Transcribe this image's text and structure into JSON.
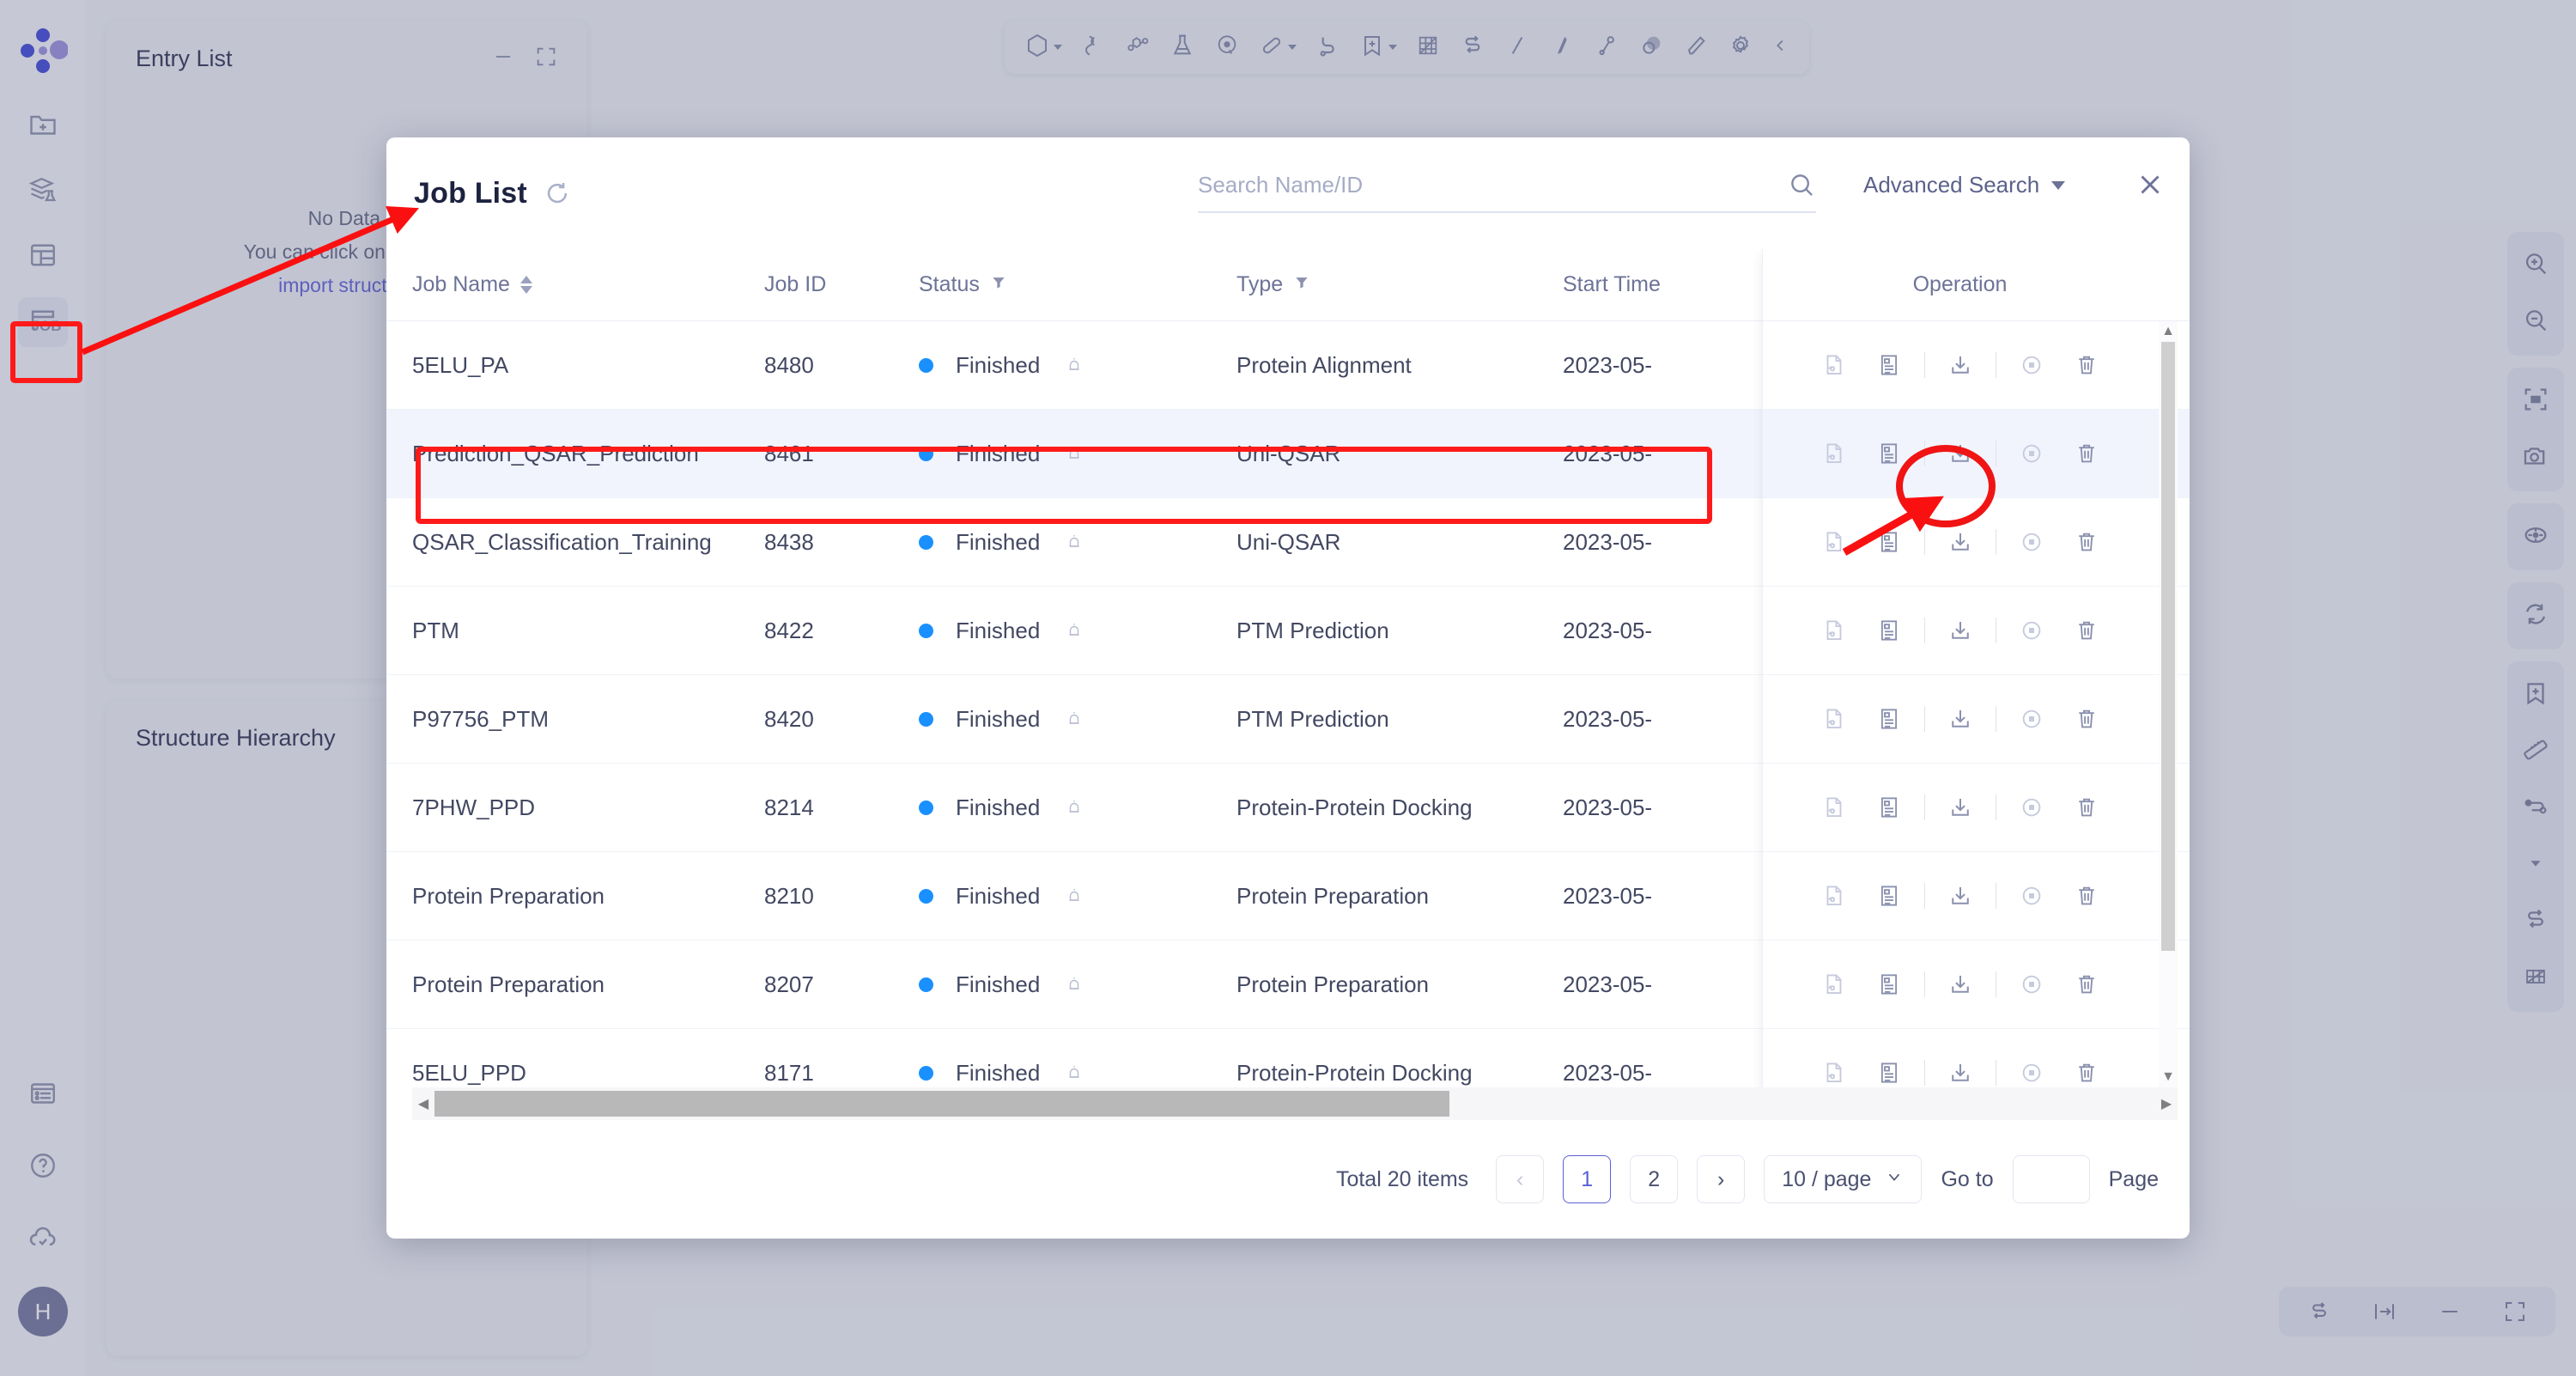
{
  "app": {
    "rail": {
      "logo_name": "app-logo",
      "items": [
        {
          "name": "new-folder",
          "icon": "folder-plus-icon"
        },
        {
          "name": "library",
          "icon": "stack-flask-icon"
        },
        {
          "name": "table-view",
          "icon": "table-icon"
        },
        {
          "name": "job-list",
          "icon": "job-icon",
          "label": "JOB",
          "active": true
        }
      ],
      "bottom_items": [
        {
          "name": "news",
          "icon": "browser-list-icon"
        },
        {
          "name": "help",
          "icon": "question-circle-icon"
        },
        {
          "name": "cloud-sync",
          "icon": "cloud-check-icon"
        }
      ],
      "avatar_initial": "H"
    },
    "toolbar": {
      "items": [
        {
          "name": "shape-tool",
          "icon": "hexagon-icon",
          "caret": true
        },
        {
          "name": "ribbon-tool",
          "icon": "ribbon-icon",
          "caret": false
        },
        {
          "name": "molecule-tool",
          "icon": "molecule-icon",
          "caret": false
        },
        {
          "name": "flask-tool",
          "icon": "flask-icon",
          "caret": false
        },
        {
          "name": "surface-tool",
          "icon": "surface-icon",
          "caret": false
        },
        {
          "name": "pill-tool",
          "icon": "capsule-icon",
          "caret": true
        },
        {
          "name": "chain-tool",
          "icon": "chain-icon",
          "caret": false
        },
        {
          "name": "label-tool",
          "icon": "bookmark-plus-icon",
          "caret": true
        },
        {
          "name": "map-tool",
          "icon": "mesh-icon",
          "caret": false
        },
        {
          "name": "exchange-tool",
          "icon": "exchange-icon",
          "caret": false
        },
        {
          "name": "line-tool",
          "icon": "slash-icon",
          "caret": false
        },
        {
          "name": "stick-tool",
          "icon": "stick-icon",
          "caret": false
        },
        {
          "name": "bond-tool",
          "icon": "bond-icon",
          "caret": false
        },
        {
          "name": "sphere-tool",
          "icon": "spheres-icon",
          "caret": false
        },
        {
          "name": "pencil-tool",
          "icon": "pencil-icon",
          "caret": false
        },
        {
          "name": "settings-tool",
          "icon": "gear-icon",
          "caret": false
        },
        {
          "name": "collapse-toolbar",
          "icon": "chevron-left-icon",
          "caret": false
        }
      ]
    },
    "entry_panel": {
      "title": "Entry List",
      "empty_line1": "No Data.",
      "empty_line2": "You can click on the left",
      "empty_link": "import structure"
    },
    "hierarchy_panel": {
      "title": "Structure Hierarchy"
    },
    "vrail": [
      {
        "name": "zoom-in",
        "icon": "zoom-in-icon"
      },
      {
        "name": "zoom-out",
        "icon": "zoom-out-icon"
      },
      {
        "name": "fit-screen",
        "icon": "fit-screen-icon"
      },
      {
        "name": "screenshot",
        "icon": "camera-icon"
      },
      {
        "name": "center-target",
        "icon": "target-icon"
      },
      {
        "name": "reset-view",
        "icon": "refresh-icon"
      },
      {
        "name": "add-label",
        "icon": "bookmark-plus-icon"
      },
      {
        "name": "measure",
        "icon": "ruler-icon"
      },
      {
        "name": "distance",
        "icon": "distance-icon"
      },
      {
        "name": "more-measure",
        "icon": "chevron-down-icon"
      },
      {
        "name": "exchange",
        "icon": "exchange-icon"
      },
      {
        "name": "mesh",
        "icon": "mesh-icon"
      }
    ],
    "bottom_bar": [
      {
        "name": "exchange",
        "icon": "exchange-icon"
      },
      {
        "name": "fit-width",
        "icon": "fit-width-icon"
      },
      {
        "name": "minimize",
        "icon": "minus-icon"
      },
      {
        "name": "fullscreen",
        "icon": "expand-icon"
      }
    ]
  },
  "modal": {
    "title": "Job List",
    "refresh_icon": "refresh-icon",
    "close_icon": "close-icon",
    "search": {
      "placeholder": "Search Name/ID",
      "value": "",
      "icon": "search-icon"
    },
    "advanced_search_label": "Advanced Search",
    "columns": [
      {
        "key": "name",
        "label": "Job Name",
        "sortable": true
      },
      {
        "key": "id",
        "label": "Job ID",
        "sortable": false
      },
      {
        "key": "status",
        "label": "Status",
        "filterable": true
      },
      {
        "key": "type",
        "label": "Type",
        "filterable": true
      },
      {
        "key": "time",
        "label": "Start Time",
        "sortable": false
      },
      {
        "key": "op",
        "label": "Operation",
        "sortable": false
      }
    ],
    "rows": [
      {
        "name": "5ELU_PA",
        "id": "8480",
        "status": "Finished",
        "type": "Protein Alignment",
        "time": "2023-05-",
        "selected": false
      },
      {
        "name": "Prediction_QSAR_Prediction",
        "id": "8461",
        "status": "Finished",
        "type": "Uni-QSAR",
        "time": "2023-05-",
        "selected": true
      },
      {
        "name": "QSAR_Classification_Training",
        "id": "8438",
        "status": "Finished",
        "type": "Uni-QSAR",
        "time": "2023-05-",
        "selected": false
      },
      {
        "name": "PTM",
        "id": "8422",
        "status": "Finished",
        "type": "PTM Prediction",
        "time": "2023-05-",
        "selected": false
      },
      {
        "name": "P97756_PTM",
        "id": "8420",
        "status": "Finished",
        "type": "PTM Prediction",
        "time": "2023-05-",
        "selected": false
      },
      {
        "name": "7PHW_PPD",
        "id": "8214",
        "status": "Finished",
        "type": "Protein-Protein Docking",
        "time": "2023-05-",
        "selected": false
      },
      {
        "name": "Protein Preparation",
        "id": "8210",
        "status": "Finished",
        "type": "Protein Preparation",
        "time": "2023-05-",
        "selected": false
      },
      {
        "name": "Protein Preparation",
        "id": "8207",
        "status": "Finished",
        "type": "Protein Preparation",
        "time": "2023-05-",
        "selected": false
      },
      {
        "name": "5ELU_PPD",
        "id": "8171",
        "status": "Finished",
        "type": "Protein-Protein Docking",
        "time": "2023-05-",
        "selected": false
      }
    ],
    "operations": [
      {
        "name": "preview",
        "icon": "file-eye-icon"
      },
      {
        "name": "report",
        "icon": "document-report-icon"
      },
      {
        "name": "download",
        "icon": "download-icon"
      },
      {
        "name": "stop",
        "icon": "stop-circle-icon"
      },
      {
        "name": "delete",
        "icon": "trash-icon"
      }
    ],
    "pagination": {
      "total_text": "Total 20 items",
      "prev_label": "‹",
      "pages": [
        "1",
        "2"
      ],
      "current_page": "1",
      "next_label": "›",
      "page_size_label": "10 / page",
      "goto_label": "Go to",
      "goto_value": "",
      "page_suffix": "Page"
    }
  },
  "annotations": {
    "color": "#ff1a1a",
    "highlight_rail_item": "job-list",
    "highlight_row_id": "8461",
    "circled_action": "download"
  }
}
